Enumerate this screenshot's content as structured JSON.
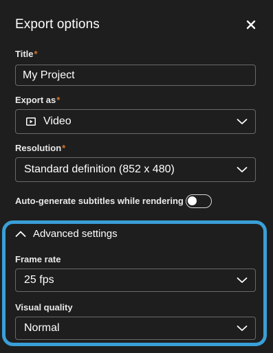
{
  "dialog": {
    "title": "Export options"
  },
  "fields": {
    "title": {
      "label": "Title",
      "required_mark": "*",
      "value": "My Project"
    },
    "export_as": {
      "label": "Export as",
      "required_mark": "*",
      "value": "Video"
    },
    "resolution": {
      "label": "Resolution",
      "required_mark": "*",
      "value": "Standard definition (852 x 480)"
    }
  },
  "subtitles_toggle": {
    "label": "Auto-generate subtitles while rendering",
    "enabled": false
  },
  "advanced": {
    "heading": "Advanced settings",
    "expanded": true,
    "frame_rate": {
      "label": "Frame rate",
      "value": "25 fps"
    },
    "visual_quality": {
      "label": "Visual quality",
      "value": "Normal"
    }
  },
  "colors": {
    "background": "#1e1e1e",
    "required": "#d8742e",
    "highlight": "#3a9fd8",
    "border": "#6b6b6b"
  },
  "icons": {
    "close": "close-icon",
    "chevron_down": "chevron-down-icon",
    "chevron_up": "chevron-up-icon",
    "video": "video-icon"
  }
}
